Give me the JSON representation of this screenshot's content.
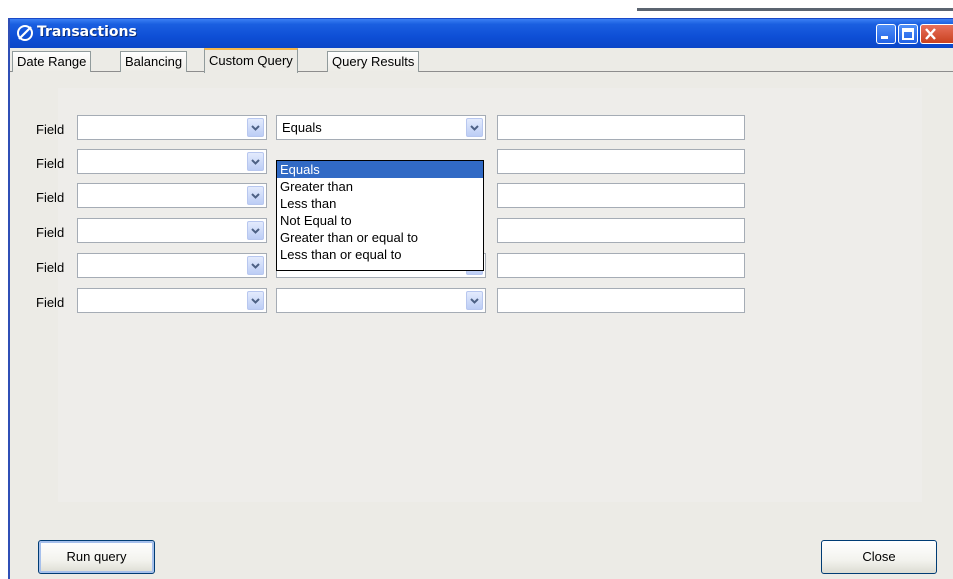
{
  "window": {
    "title": "Transactions"
  },
  "tabs": [
    {
      "label": "Date Range"
    },
    {
      "label": "Balancing"
    },
    {
      "label": "Custom Query"
    },
    {
      "label": "Query Results"
    }
  ],
  "active_tab": "Custom Query",
  "query_rows": [
    {
      "label": "Field",
      "field_value": "",
      "operator_value": "Equals",
      "value": ""
    },
    {
      "label": "Field",
      "field_value": "",
      "operator_value": "",
      "value": ""
    },
    {
      "label": "Field",
      "field_value": "",
      "operator_value": "",
      "value": ""
    },
    {
      "label": "Field",
      "field_value": "",
      "operator_value": "",
      "value": ""
    },
    {
      "label": "Field",
      "field_value": "",
      "operator_value": "",
      "value": ""
    },
    {
      "label": "Field",
      "field_value": "",
      "operator_value": "",
      "value": ""
    }
  ],
  "operator_dropdown": {
    "open": true,
    "selected": "Equals",
    "options": [
      "Equals",
      "Greater than",
      "Less than",
      "Not Equal to",
      "Greater than or equal to",
      "Less than or equal to"
    ]
  },
  "buttons": {
    "run_query": "Run query",
    "close": "Close"
  },
  "colors": {
    "titlebar": "#0e4fd6",
    "selection": "#316ac5",
    "active_tab_accent": "#f7b84a",
    "window_bg": "#ecebe6"
  }
}
